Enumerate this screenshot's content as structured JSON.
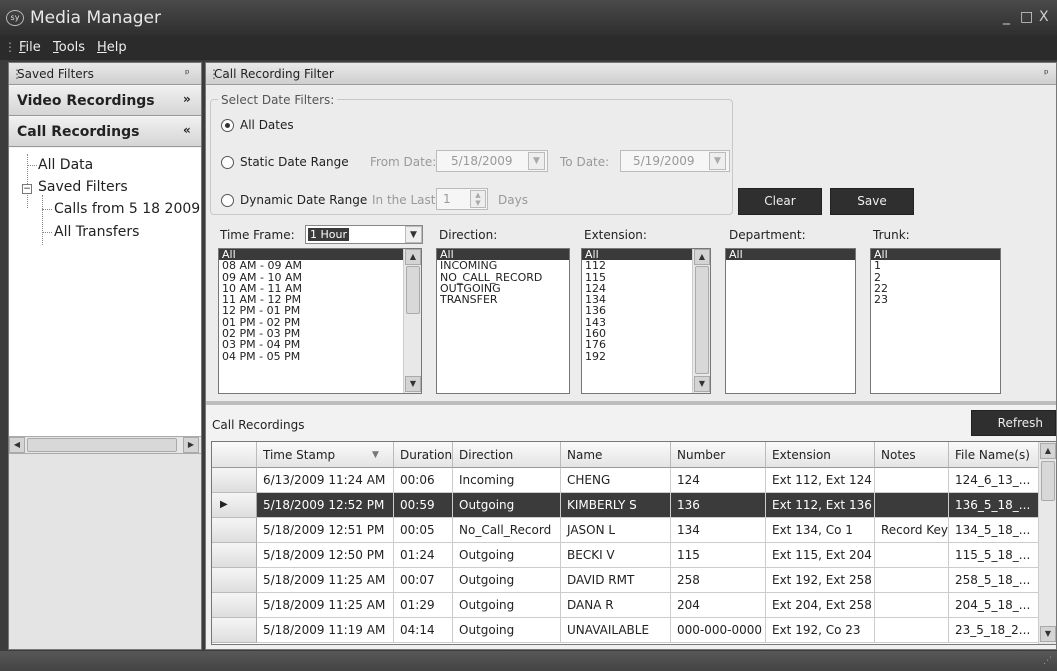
{
  "window": {
    "title": "Media Manager",
    "logo": "sy",
    "controls": [
      "_",
      "□",
      "X"
    ]
  },
  "menu": {
    "items": [
      {
        "u": "F",
        "rest": "ile"
      },
      {
        "u": "T",
        "rest": "ools"
      },
      {
        "u": "H",
        "rest": "elp"
      }
    ]
  },
  "left": {
    "saved_filters_header": "Saved Filters",
    "video_recordings": "Video Recordings",
    "call_recordings": "Call Recordings",
    "tree": [
      "All Data",
      "Saved Filters",
      "Calls from 5 18 2009",
      "All Transfers"
    ]
  },
  "filter": {
    "header": "Call Recording Filter",
    "date_group_label": "Select Date Filters:",
    "all_dates": "All Dates",
    "static_range": "Static Date Range",
    "from_date_label": "From Date:",
    "from_date": "5/18/2009",
    "to_date_label": "To Date:",
    "to_date": "5/19/2009",
    "dynamic_range": "Dynamic Date Range",
    "in_the_last": "In the Last:",
    "last_value": "1",
    "days": "Days",
    "clear": "Clear",
    "save": "Save",
    "time_frame_label": "Time Frame:",
    "time_frame_value": "1 Hour",
    "direction_label": "Direction:",
    "extension_label": "Extension:",
    "department_label": "Department:",
    "trunk_label": "Trunk:",
    "time_list": [
      "All",
      "08 AM - 09 AM",
      "09 AM - 10 AM",
      "10 AM - 11 AM",
      "11 AM - 12 PM",
      "12 PM - 01 PM",
      "01 PM - 02 PM",
      "02 PM - 03 PM",
      "03 PM - 04 PM",
      "04 PM - 05 PM"
    ],
    "direction_list": [
      "All",
      "INCOMING",
      "NO_CALL_RECORD",
      "OUTGOING",
      "TRANSFER"
    ],
    "extension_list": [
      "All",
      "112",
      "115",
      "124",
      "134",
      "136",
      "143",
      "160",
      "176",
      "192"
    ],
    "department_list": [
      "All"
    ],
    "trunk_list": [
      "All",
      "1",
      "2",
      "22",
      "23"
    ]
  },
  "recordings": {
    "header": "Call Recordings",
    "refresh": "Refresh",
    "columns": [
      "Time Stamp",
      "Duration",
      "Direction",
      "Name",
      "Number",
      "Extension",
      "Notes",
      "File Name(s)"
    ],
    "rows": [
      [
        "6/13/2009 11:24 AM",
        "00:06",
        "Incoming",
        "CHENG",
        "124",
        "Ext 112, Ext 124",
        "",
        "124_6_13_..."
      ],
      [
        "5/18/2009 12:52 PM",
        "00:59",
        "Outgoing",
        "KIMBERLY S",
        "136",
        "Ext 112, Ext 136",
        "",
        "136_5_18_..."
      ],
      [
        "5/18/2009 12:51 PM",
        "00:05",
        "No_Call_Record",
        "JASON L",
        "134",
        "Ext 134, Co 1",
        "Record Key",
        "134_5_18_..."
      ],
      [
        "5/18/2009 12:50 PM",
        "01:24",
        "Outgoing",
        "BECKI V",
        "115",
        "Ext 115, Ext 204",
        "",
        "115_5_18_..."
      ],
      [
        "5/18/2009 11:25 AM",
        "00:07",
        "Outgoing",
        "DAVID RMT",
        "258",
        "Ext 192, Ext 258",
        "",
        "258_5_18_..."
      ],
      [
        "5/18/2009 11:25 AM",
        "01:29",
        "Outgoing",
        "DANA R",
        "204",
        "Ext 204, Ext 258",
        "",
        "204_5_18_..."
      ],
      [
        "5/18/2009 11:19 AM",
        "04:14",
        "Outgoing",
        "UNAVAILABLE",
        "000-000-0000",
        "Ext 192, Co 23",
        "",
        "23_5_18_2..."
      ]
    ],
    "selected_row": 1
  }
}
